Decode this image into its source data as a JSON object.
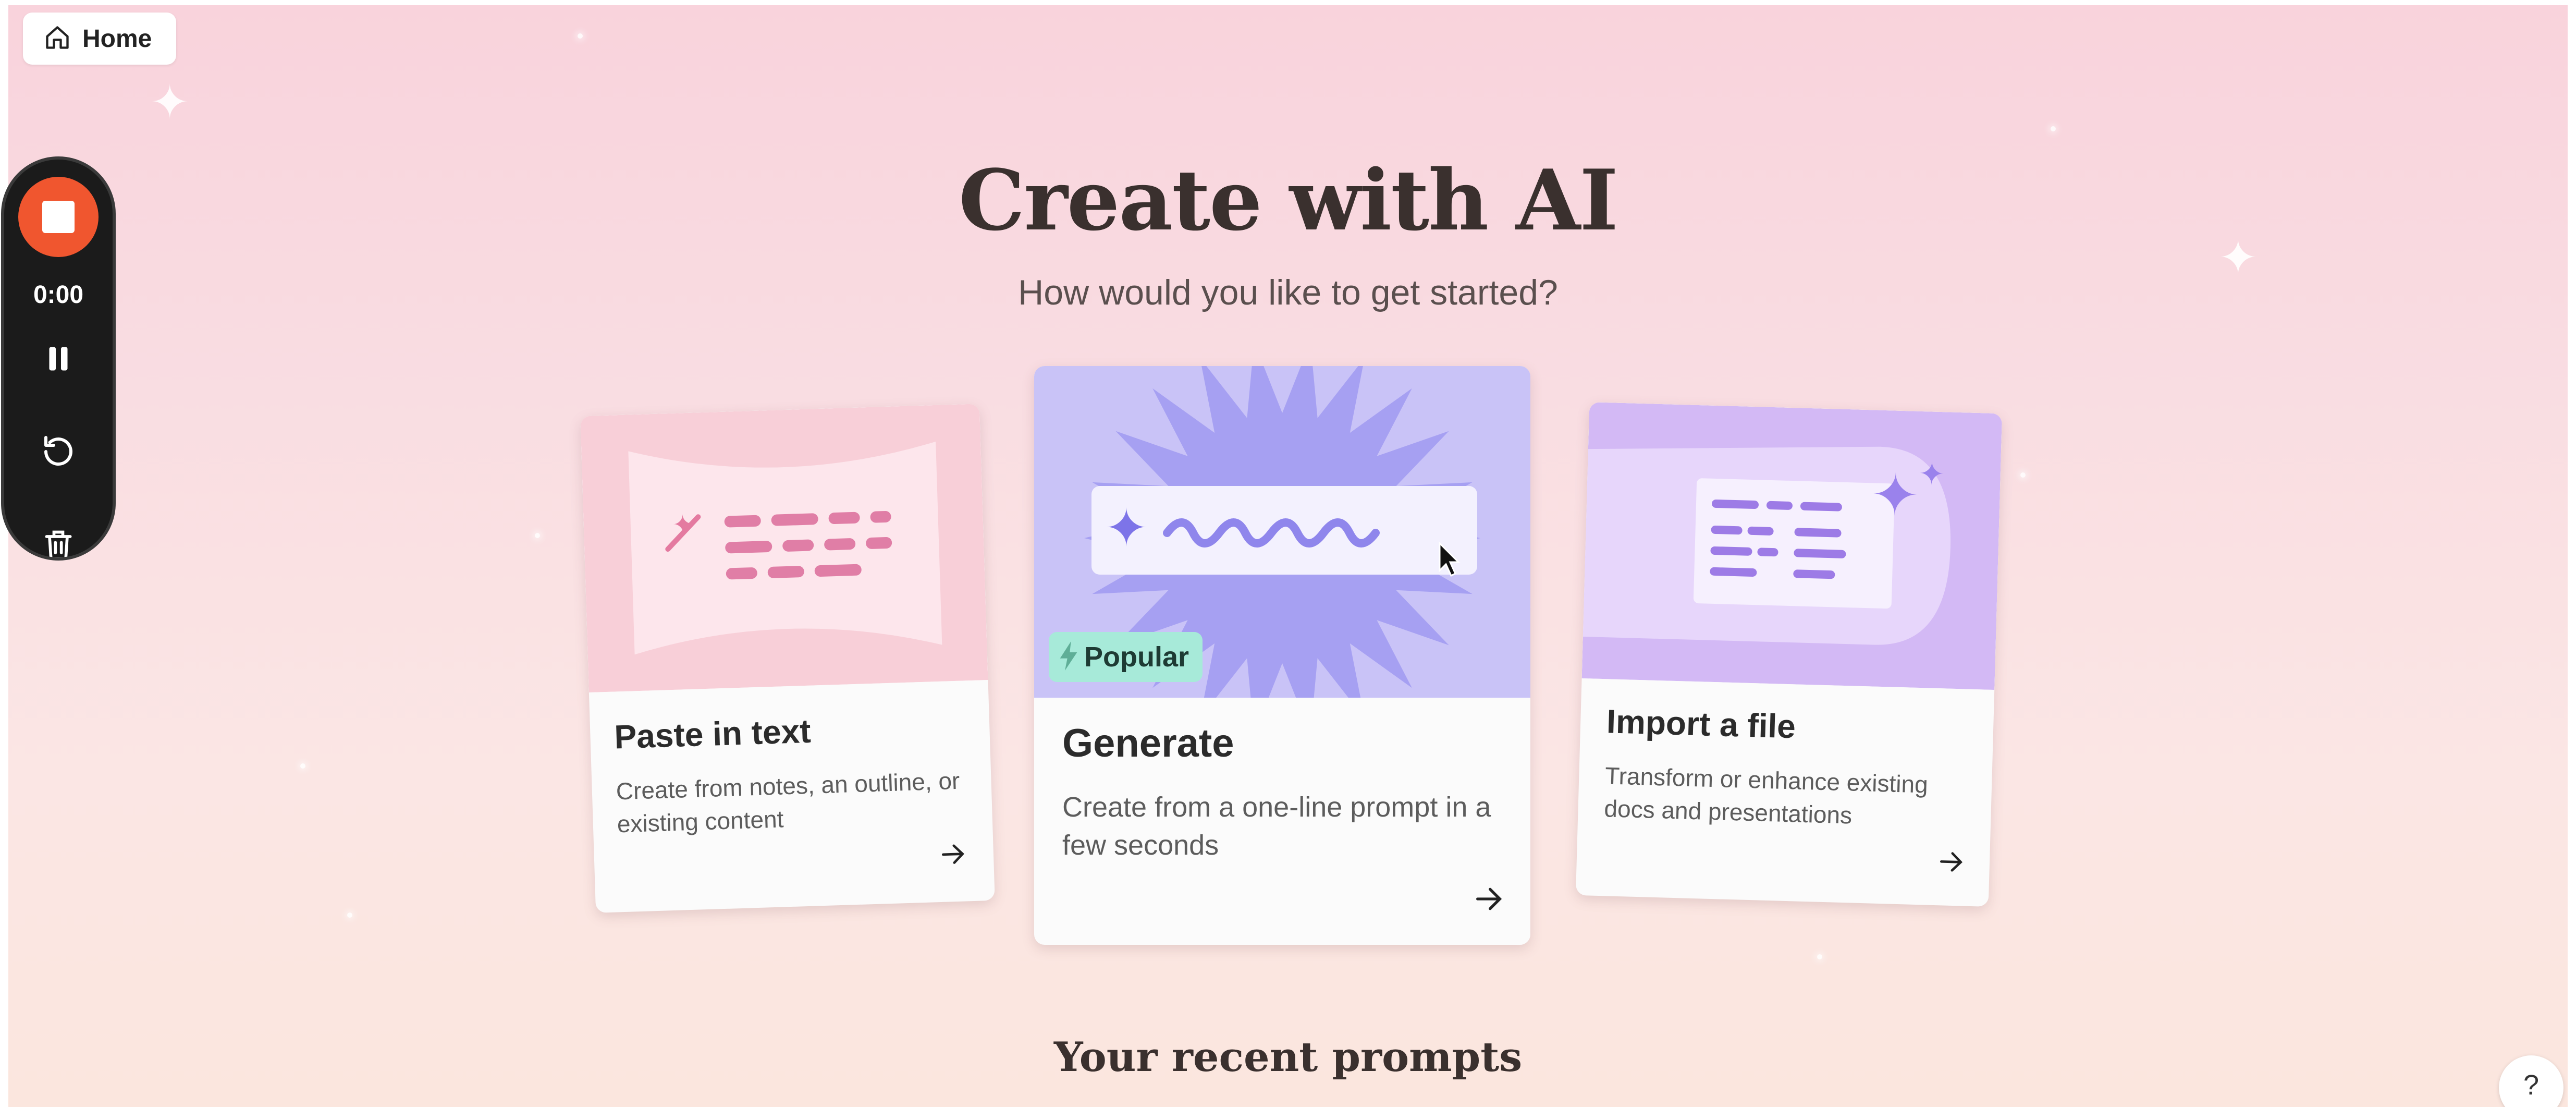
{
  "nav": {
    "home_label": "Home"
  },
  "recorder": {
    "time": "0:00"
  },
  "header": {
    "title": "Create with AI",
    "subtitle": "How would you like to get started?"
  },
  "cards": [
    {
      "title": "Paste in text",
      "description": "Create from notes, an outline, or existing content"
    },
    {
      "title": "Generate",
      "description": "Create from a one-line prompt in a few seconds",
      "badge": "Popular"
    },
    {
      "title": "Import a file",
      "description": "Transform or enhance existing docs and presentations"
    }
  ],
  "recent": {
    "heading": "Your recent prompts"
  },
  "help": {
    "label": "?"
  },
  "colors": {
    "record_red": "#f0562f",
    "popular_badge": "#a7ead9",
    "generate_art": "#c9c3f7",
    "starburst": "#a6a0f2",
    "paste_art": "#f8cfd8",
    "import_art": "#d3b9f5"
  }
}
